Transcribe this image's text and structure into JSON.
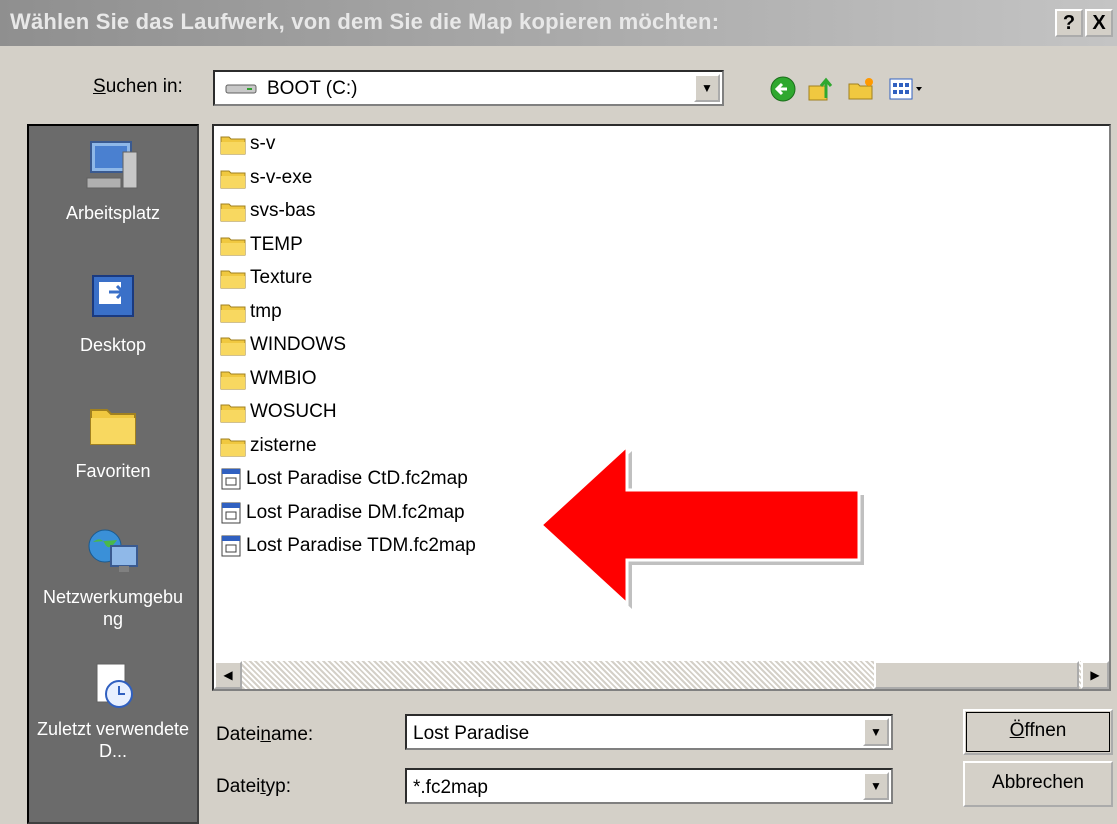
{
  "title": "Wählen Sie das Laufwerk, von dem Sie die Map kopieren möchten:",
  "titlebar_buttons": {
    "help": "?",
    "close": "X"
  },
  "lookin": {
    "label_u": "S",
    "label_rest": "uchen in:",
    "value": "BOOT (C:)"
  },
  "toolbar_icons": [
    "back-icon",
    "up-folder-icon",
    "new-folder-icon",
    "view-menu-icon"
  ],
  "places": [
    {
      "label": "Arbeitsplatz",
      "icon": "my-computer-icon"
    },
    {
      "label": "Desktop",
      "icon": "desktop-icon"
    },
    {
      "label": "Favoriten",
      "icon": "favorites-folder-icon"
    },
    {
      "label": "Netzwerkumgebung",
      "icon": "network-icon"
    },
    {
      "label": "Zuletzt verwendete D...",
      "icon": "recent-docs-icon"
    }
  ],
  "files": [
    {
      "name": "s-v",
      "type": "folder"
    },
    {
      "name": "s-v-exe",
      "type": "folder"
    },
    {
      "name": "svs-bas",
      "type": "folder"
    },
    {
      "name": "TEMP",
      "type": "folder"
    },
    {
      "name": "Texture",
      "type": "folder"
    },
    {
      "name": "tmp",
      "type": "folder"
    },
    {
      "name": "WINDOWS",
      "type": "folder"
    },
    {
      "name": "WMBIO",
      "type": "folder"
    },
    {
      "name": "WOSUCH",
      "type": "folder"
    },
    {
      "name": "zisterne",
      "type": "folder"
    },
    {
      "name": "Lost Paradise CtD.fc2map",
      "type": "file"
    },
    {
      "name": "Lost Paradise DM.fc2map",
      "type": "file"
    },
    {
      "name": "Lost Paradise TDM.fc2map",
      "type": "file"
    }
  ],
  "filename": {
    "label_pre": "Datei",
    "label_u": "n",
    "label_post": "ame:",
    "value": "Lost Paradise"
  },
  "filetype": {
    "label_pre": "Datei",
    "label_u": "t",
    "label_post": "yp:",
    "value": "*.fc2map"
  },
  "buttons": {
    "open_u": "Ö",
    "open_rest": "ffnen",
    "cancel": "Abbrechen"
  },
  "colors": {
    "arrow": "#ff0000",
    "places_bg": "#6b6b6b",
    "dialog_bg": "#d4d0c8"
  }
}
